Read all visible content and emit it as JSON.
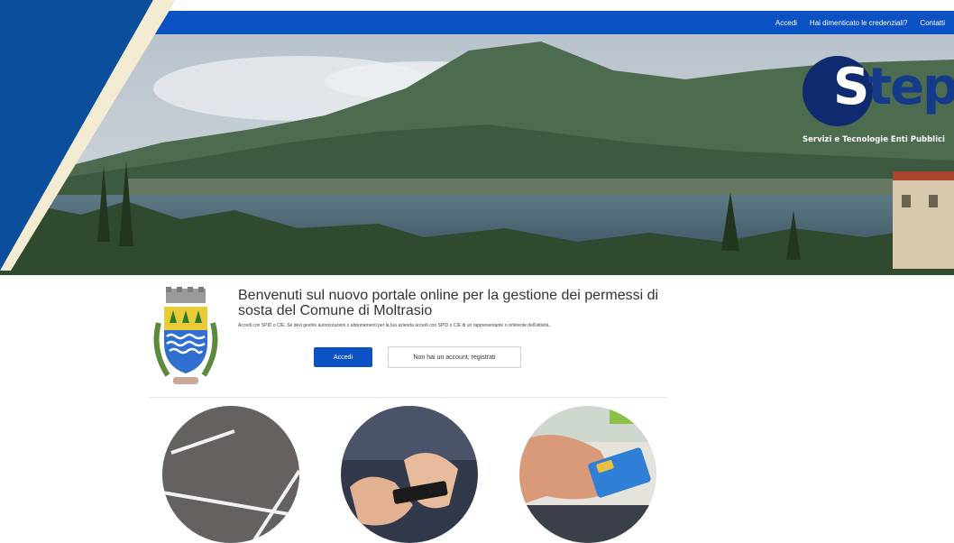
{
  "topbar": {
    "links": [
      "Accedi",
      "Hai dimenticato le credenziali?",
      "Contatti"
    ]
  },
  "brand": {
    "logo_letter": "S",
    "logo_rest": "tep",
    "tagline": "Servizi e Tecnologie Enti Pubblici",
    "colors": {
      "accent": "#0a51c4",
      "diagonal": "#0b4e9c",
      "stripe": "#f3ecd2"
    }
  },
  "intro": {
    "title": "Benvenuti sul nuovo portale online per la gestione dei permessi di sosta del Comune di Moltrasio",
    "description": "Accedi con SPID o CIE. Se devi gestire autorizzazioni o abbonamenti per la tua azienda accedi con SPID o CIE di un rappresentante o referente dell'attività.",
    "login_button": "Accedi",
    "register_button": "Non hai un account, registrati"
  },
  "images": {
    "hero": "lake-landscape",
    "crest": "municipal-coat-of-arms",
    "cards": [
      "parking-lot-icon",
      "smartphone-icon",
      "credit-card-icon"
    ]
  }
}
